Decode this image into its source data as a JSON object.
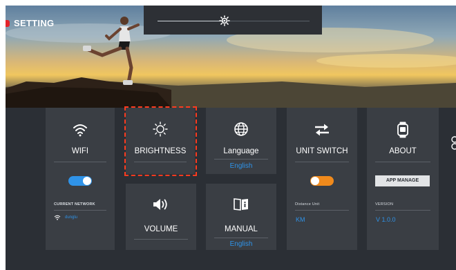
{
  "header": {
    "title": "SETTING"
  },
  "brightness_slider": {
    "level_percent": 44,
    "icon": "brightness-icon"
  },
  "cards": {
    "wifi": {
      "label": "WIFI",
      "icon": "wifi-icon",
      "toggle_on": true,
      "network_label": "CURRENT NETWORK",
      "network_name": "dunglu"
    },
    "brightness": {
      "label": "BRIGHTNESS",
      "icon": "sun-icon"
    },
    "language": {
      "label": "Language",
      "icon": "globe-icon",
      "value": "English"
    },
    "volume": {
      "label": "VOLUME",
      "icon": "speaker-icon"
    },
    "manual": {
      "label": "MANUAL",
      "icon": "book-icon",
      "value": "English"
    },
    "unit_switch": {
      "label": "UNIT SWITCH",
      "icon": "swap-arrows-icon",
      "toggle_on": true,
      "unit_label": "Distance Unit",
      "unit_value": "KM"
    },
    "about": {
      "label": "ABOUT",
      "icon": "watch-icon",
      "app_manage": "APP MANAGE",
      "version_label": "VERSION",
      "version_value": "V 1.0.0"
    }
  },
  "colors": {
    "accent_blue": "#2f93e8",
    "toggle_orange": "#f08a1c",
    "focus_red": "#ff3b1f",
    "title_dot": "#e3242b"
  }
}
